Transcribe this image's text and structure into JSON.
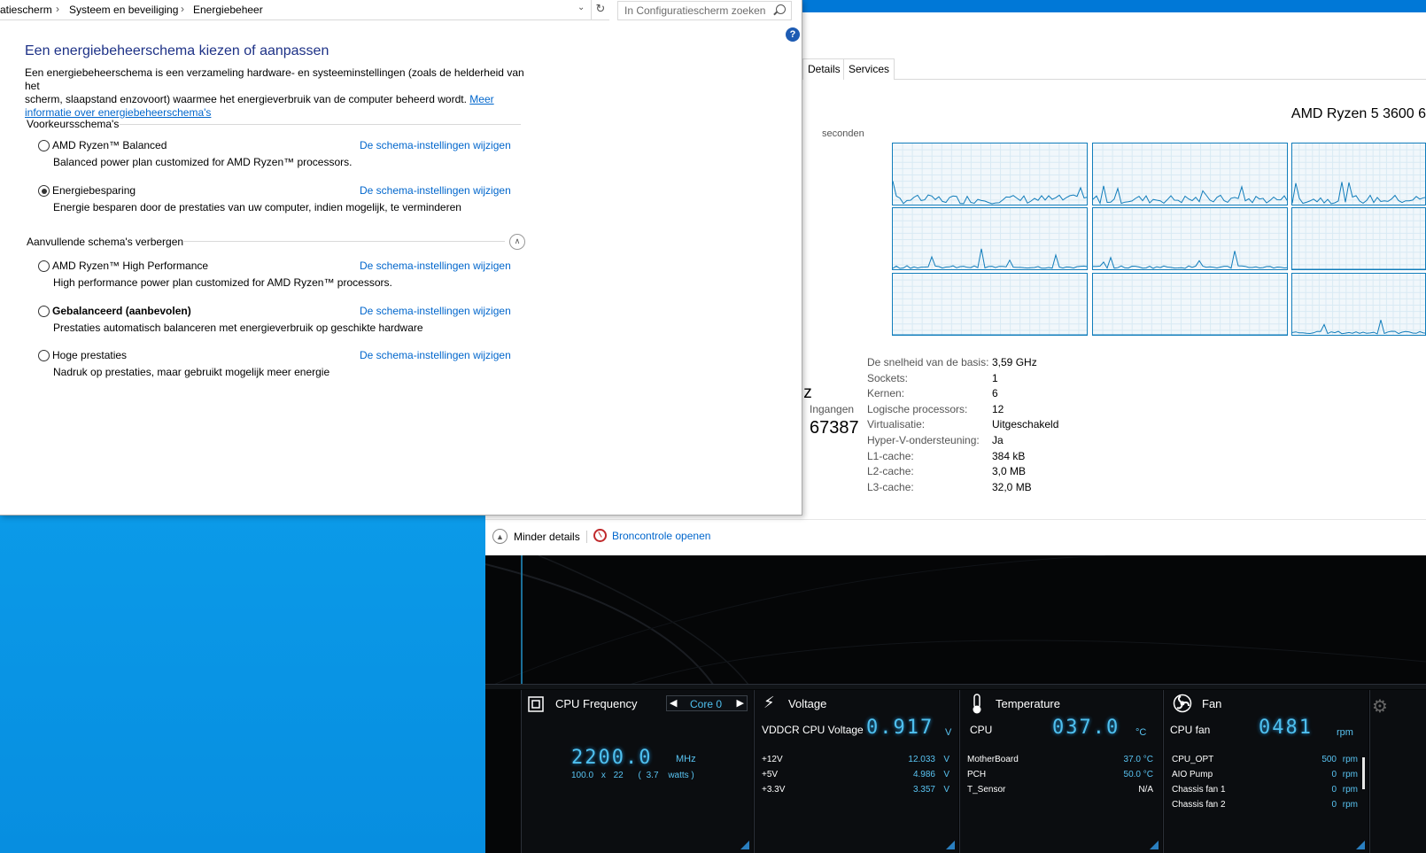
{
  "control_panel": {
    "breadcrumb": [
      "atiescherm",
      "Systeem en beveiliging",
      "Energiebeheer"
    ],
    "search_placeholder": "In Configuratiescherm zoeken",
    "title": "Een energiebeheerschema kiezen of aanpassen",
    "intro_line1": "Een energiebeheerschema is een verzameling hardware- en systeeminstellingen (zoals de helderheid van het",
    "intro_line2": "scherm, slaapstand enzovoort) waarmee het energieverbruik van de computer beheerd wordt.",
    "intro_link_part1": "Meer",
    "intro_link_part2": "informatie over energiebeheerschema's",
    "preferred_heading": "Voorkeursschema's",
    "additional_heading": "Aanvullende schema's verbergen",
    "change_link": "De schema-instellingen wijzigen",
    "plans": [
      {
        "name": "AMD Ryzen™ Balanced",
        "desc": "Balanced power plan customized for AMD Ryzen™ processors.",
        "selected": false,
        "bold": false
      },
      {
        "name": "Energiebesparing",
        "desc": "Energie besparen door de prestaties van uw computer, indien mogelijk, te verminderen",
        "selected": true,
        "bold": false
      },
      {
        "name": "AMD Ryzen™ High Performance",
        "desc": "High performance power plan customized for AMD Ryzen™ processors.",
        "selected": false,
        "bold": false
      },
      {
        "name": "Gebalanceerd (aanbevolen)",
        "desc": "Prestaties automatisch balanceren met energieverbruik op geschikte hardware",
        "selected": false,
        "bold": true
      },
      {
        "name": "Hoge prestaties",
        "desc": "Nadruk op prestaties, maar gebruikt mogelijk meer energie",
        "selected": false,
        "bold": false
      }
    ]
  },
  "task_manager": {
    "tabs": [
      "Details",
      "Services"
    ],
    "cpu_name": "AMD Ryzen 5 3600 6",
    "graph_caption": "seconden",
    "freq_fragment": "lz",
    "handles_label": "Ingangen",
    "handles_value": "67387",
    "specs": [
      {
        "label": "De snelheid van de basis:",
        "value": "3,59 GHz"
      },
      {
        "label": "Sockets:",
        "value": "1"
      },
      {
        "label": "Kernen:",
        "value": "6"
      },
      {
        "label": "Logische processors:",
        "value": "12"
      },
      {
        "label": "Virtualisatie:",
        "value": "Uitgeschakeld"
      },
      {
        "label": "Hyper-V-ondersteuning:",
        "value": "Ja"
      },
      {
        "label": "L1-cache:",
        "value": "384 kB"
      },
      {
        "label": "L2-cache:",
        "value": "3,0 MB"
      },
      {
        "label": "L3-cache:",
        "value": "32,0 MB"
      }
    ],
    "fewer_details": "Minder details",
    "resource_monitor": "Broncontrole openen",
    "graph_line_color": "#117dbb"
  },
  "hw_monitor": {
    "cpu_freq": {
      "title": "CPU Frequency",
      "core_selector": "Core 0",
      "value": "2200.0",
      "unit": "MHz",
      "bclk": "100.0",
      "x": "x",
      "multiplier": "22",
      "watts_open": "(",
      "watts": "3.7",
      "watts_unit": "watts )"
    },
    "voltage": {
      "title": "Voltage",
      "main_label": "VDDCR CPU Voltage",
      "main_value": "0.917",
      "main_unit": "V",
      "rows": [
        {
          "label": "+12V",
          "value": "12.033",
          "unit": "V"
        },
        {
          "label": "+5V",
          "value": "4.986",
          "unit": "V"
        },
        {
          "label": "+3.3V",
          "value": "3.357",
          "unit": "V"
        }
      ]
    },
    "temperature": {
      "title": "Temperature",
      "main_label": "CPU",
      "main_value": "037.0",
      "main_unit": "°C",
      "rows": [
        {
          "label": "MotherBoard",
          "value": "37.0 °C"
        },
        {
          "label": "PCH",
          "value": "50.0 °C"
        },
        {
          "label": "T_Sensor",
          "value": "N/A"
        }
      ]
    },
    "fan": {
      "title": "Fan",
      "main_label": "CPU fan",
      "main_value": "0481",
      "main_unit": "rpm",
      "rows": [
        {
          "label": "CPU_OPT",
          "value": "500",
          "unit": "rpm"
        },
        {
          "label": "AIO Pump",
          "value": "0",
          "unit": "rpm"
        },
        {
          "label": "Chassis fan 1",
          "value": "0",
          "unit": "rpm"
        },
        {
          "label": "Chassis fan 2",
          "value": "0",
          "unit": "rpm"
        }
      ]
    },
    "accent_color": "#4fc0ef"
  }
}
